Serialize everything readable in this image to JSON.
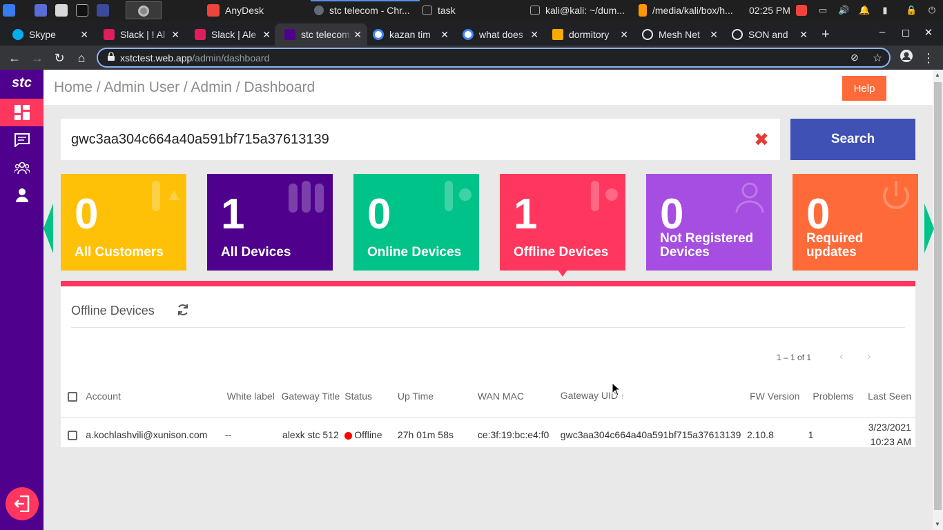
{
  "taskbar": {
    "anydesk": "AnyDesk",
    "chrome_window": "stc telecom - Chr...",
    "task": "task",
    "terminal": "kali@kali: ~/dum...",
    "files": "/media/kali/box/h...",
    "clock": "02:25 PM"
  },
  "tabs": [
    {
      "title": "Skype",
      "color": "#00aff0"
    },
    {
      "title": "Slack | ! Al",
      "color": "#4a154b"
    },
    {
      "title": "Slack | Ale",
      "color": "#4a154b"
    },
    {
      "title": "stc telecom",
      "color": "#4f008c"
    },
    {
      "title": "kazan tim",
      "color": "#ffffff"
    },
    {
      "title": "what does",
      "color": "#ffffff"
    },
    {
      "title": "dormitory",
      "color": "#f9ab00"
    },
    {
      "title": "Mesh Net",
      "color": "#9aa0a6"
    },
    {
      "title": "SON and",
      "color": "#9aa0a6"
    }
  ],
  "address_bar": {
    "host": "xstctest.web.app",
    "path": "/admin/dashboard"
  },
  "app": {
    "logo": "stc",
    "brand_color": "#4f008c",
    "accent_color": "#ff375e"
  },
  "header": {
    "breadcrumb": "Home / Admin User / Admin / Dashboard",
    "help_label": "Help"
  },
  "search": {
    "value": "gwc3aa304c664a40a591bf715a37613139",
    "button_label": "Search"
  },
  "cards": [
    {
      "count": "0",
      "label": "All Customers",
      "color": "#ffc107"
    },
    {
      "count": "1",
      "label": "All Devices",
      "color": "#4f008c"
    },
    {
      "count": "0",
      "label": "Online Devices",
      "color": "#00c389"
    },
    {
      "count": "1",
      "label": "Offline Devices",
      "color": "#ff375e"
    },
    {
      "count": "0",
      "label": "Not Registered Devices",
      "color": "#a54ee1"
    },
    {
      "count": "0",
      "label": "Required updates",
      "color": "#ff6a39"
    }
  ],
  "panel": {
    "title": "Offline Devices",
    "pager": "1 – 1 of 1"
  },
  "table": {
    "headers": {
      "account": "Account",
      "white_label": "White label",
      "gateway_title": "Gateway Title",
      "status": "Status",
      "up_time": "Up Time",
      "wan_mac": "WAN MAC",
      "gateway_uid": "Gateway UID",
      "fw_version": "FW Version",
      "problems": "Problems",
      "last_seen": "Last Seen"
    },
    "rows": [
      {
        "account": "a.kochlashvili@xunison.com",
        "white_label": "--",
        "gateway_title": "alexk stc 512",
        "status": "Offline",
        "up_time": "27h 01m 58s",
        "wan_mac": "ce:3f:19:bc:e4:f0",
        "gateway_uid": "gwc3aa304c664a40a591bf715a37613139",
        "fw_version": "2.10.8",
        "problems": "1",
        "last_seen": "3/23/2021 10:23 AM"
      }
    ]
  }
}
